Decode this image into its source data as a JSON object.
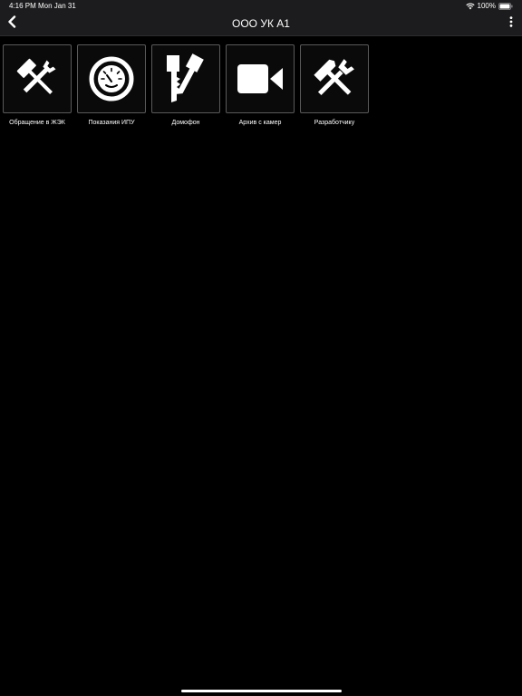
{
  "status_bar": {
    "time": "4:16 PM",
    "date": "Mon Jan 31",
    "battery": "100%"
  },
  "nav": {
    "title": "ООО УК А1",
    "back_icon": "chevron-left-icon",
    "menu_icon": "more-vertical-icon"
  },
  "tiles": [
    {
      "label": "Обращение в ЖЭК",
      "icon": "hammer-wrench-icon"
    },
    {
      "label": "Показания ИПУ",
      "icon": "gauge-icon"
    },
    {
      "label": "Домофон",
      "icon": "key-icon"
    },
    {
      "label": "Архив с камер",
      "icon": "video-camera-icon"
    },
    {
      "label": "Разработчику",
      "icon": "tools-icon"
    }
  ],
  "colors": {
    "background": "#000000",
    "bar": "#1c1c1e",
    "tile_border": "#5a5a5a",
    "text": "#ffffff"
  }
}
